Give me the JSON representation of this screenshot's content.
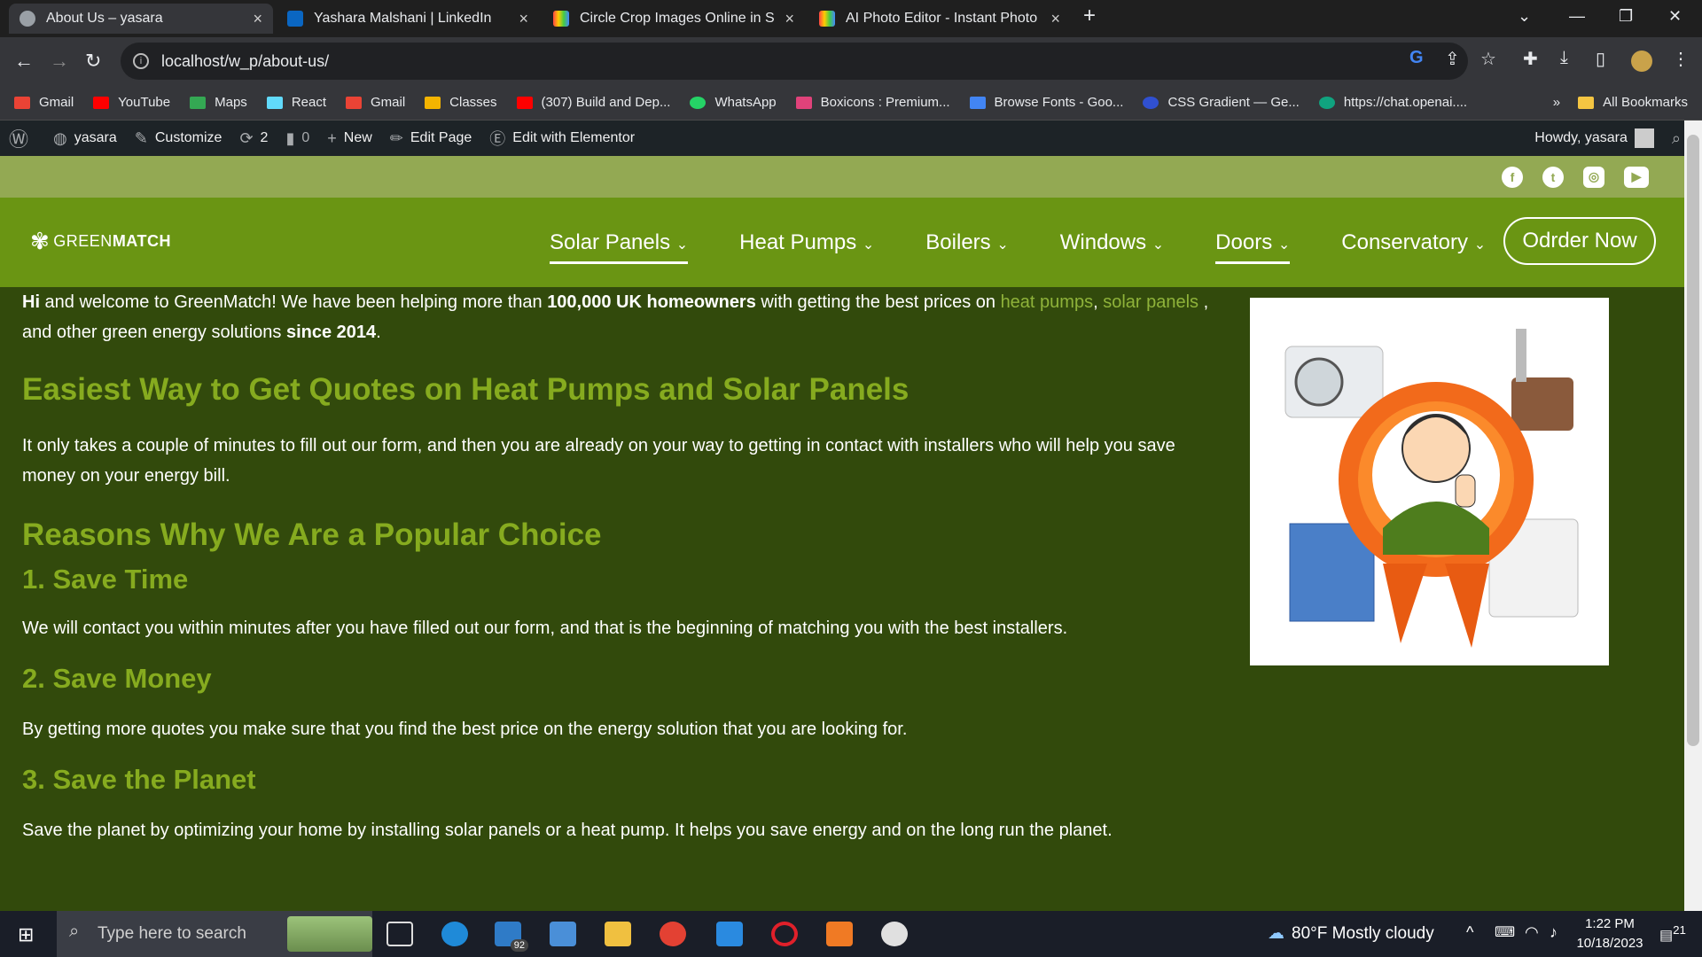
{
  "browser": {
    "tabs": [
      {
        "title": "About Us – yasara",
        "active": true
      },
      {
        "title": "Yashara Malshani | LinkedIn",
        "active": false
      },
      {
        "title": "Circle Crop Images Online in Sec",
        "active": false
      },
      {
        "title": "AI Photo Editor - Instant Photo E",
        "active": false
      }
    ],
    "url": "localhost/w_p/about-us/",
    "bookmarks": [
      "Gmail",
      "YouTube",
      "Maps",
      "React",
      "Gmail",
      "Classes",
      "(307) Build and Dep...",
      "WhatsApp",
      "Boxicons : Premium...",
      "Browse Fonts - Goo...",
      "CSS Gradient — Ge...",
      "https://chat.openai...."
    ],
    "all_bookmarks": "All Bookmarks"
  },
  "wp_admin": {
    "site": "yasara",
    "customize": "Customize",
    "updates": "2",
    "comments": "0",
    "new": "New",
    "edit_page": "Edit Page",
    "edit_elementor": "Edit with Elementor",
    "howdy": "Howdy, yasara"
  },
  "site": {
    "logo_a": "GREEN",
    "logo_b": "MATCH",
    "nav": [
      "Solar Panels",
      "Heat Pumps",
      "Boilers",
      "Windows",
      "Doors",
      "Conservatory"
    ],
    "order_button": "Odrder Now",
    "social": [
      "facebook-icon",
      "twitter-icon",
      "instagram-icon",
      "youtube-icon"
    ]
  },
  "content": {
    "intro": {
      "hi": "Hi",
      "t1": " and welcome to GreenMatch! We have been helping more than ",
      "b1": "100,000 UK homeowners",
      "t2": " with getting the best prices on ",
      "l1": "heat pumps",
      "comma": ", ",
      "l2": "solar panels",
      "t3": " , and other green energy solutions ",
      "b2": "since 2014",
      "t4": "."
    },
    "h_quotes": "Easiest Way to Get Quotes on Heat Pumps and Solar Panels",
    "p_quotes": "It only takes a couple of minutes to fill out our form, and then you are already on your way to getting in contact with installers who will help you save money on your energy bill.",
    "h_reasons": "Reasons Why We Are a Popular Choice",
    "r1_title": "1. Save Time",
    "r1_text": "We will contact you within minutes after you have filled out our form, and that is the beginning of matching you with the best installers.",
    "r2_title": "2. Save Money",
    "r2_text": "By getting more quotes you make sure that you find the best price on the energy solution that you are looking for.",
    "r3_title": "3. Save the Planet",
    "r3_text": "Save the planet by optimizing your home by installing solar panels or a heat pump. It helps you save energy and on the long run the planet."
  },
  "taskbar": {
    "search_placeholder": "Type here to search",
    "mail_badge": "92",
    "weather": "80°F  Mostly cloudy",
    "time": "1:22 PM",
    "date": "10/18/2023",
    "notif": "21"
  }
}
